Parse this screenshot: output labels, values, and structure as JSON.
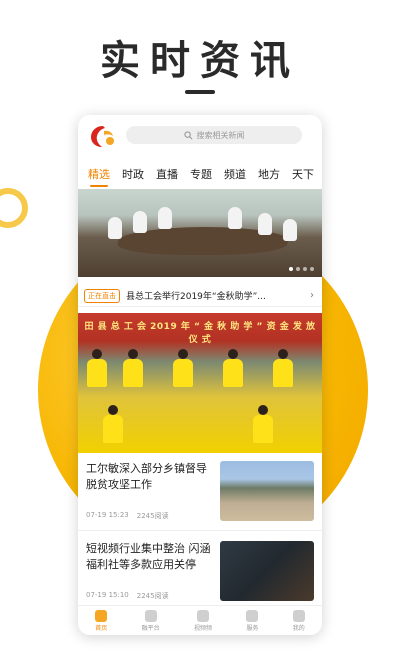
{
  "promo": {
    "title": "实时资讯"
  },
  "colors": {
    "accent": "#f08300",
    "circle": "#f7b500",
    "text": "#222222",
    "muted": "#999999"
  },
  "search": {
    "placeholder": "搜索相关新闻"
  },
  "tabs": [
    {
      "label": "精选",
      "active": true
    },
    {
      "label": "时政"
    },
    {
      "label": "直播"
    },
    {
      "label": "专题"
    },
    {
      "label": "频道"
    },
    {
      "label": "地方"
    },
    {
      "label": "天下"
    }
  ],
  "hero": {
    "carousel_total": 4,
    "carousel_active": 1
  },
  "ticker": {
    "badge": "正在直击",
    "text": "县总工会举行2019年“金秋助学”...",
    "arrow": "›"
  },
  "feature": {
    "banner": "田 县 总 工 会 2019 年 “ 金 秋 助 学 ” 资 金 发 放 仪 式"
  },
  "articles": [
    {
      "title": "工尔敏深入部分乡镇督导脱贫攻坚工作",
      "time": "07-19 15:23",
      "reads": "2245阅读",
      "thumb_icon": "news-photo"
    },
    {
      "title": "短视频行业集中整治 闪涵福利社等多款应用关停",
      "time": "07-19 15:10",
      "reads": "2245阅读",
      "thumb_icon": "news-photo"
    }
  ],
  "bottom_nav": [
    {
      "label": "首页",
      "icon": "home-icon",
      "active": true
    },
    {
      "label": "融平台",
      "icon": "chat-icon"
    },
    {
      "label": "视频频",
      "icon": "video-icon"
    },
    {
      "label": "服务",
      "icon": "service-icon"
    },
    {
      "label": "我的",
      "icon": "user-icon"
    }
  ]
}
